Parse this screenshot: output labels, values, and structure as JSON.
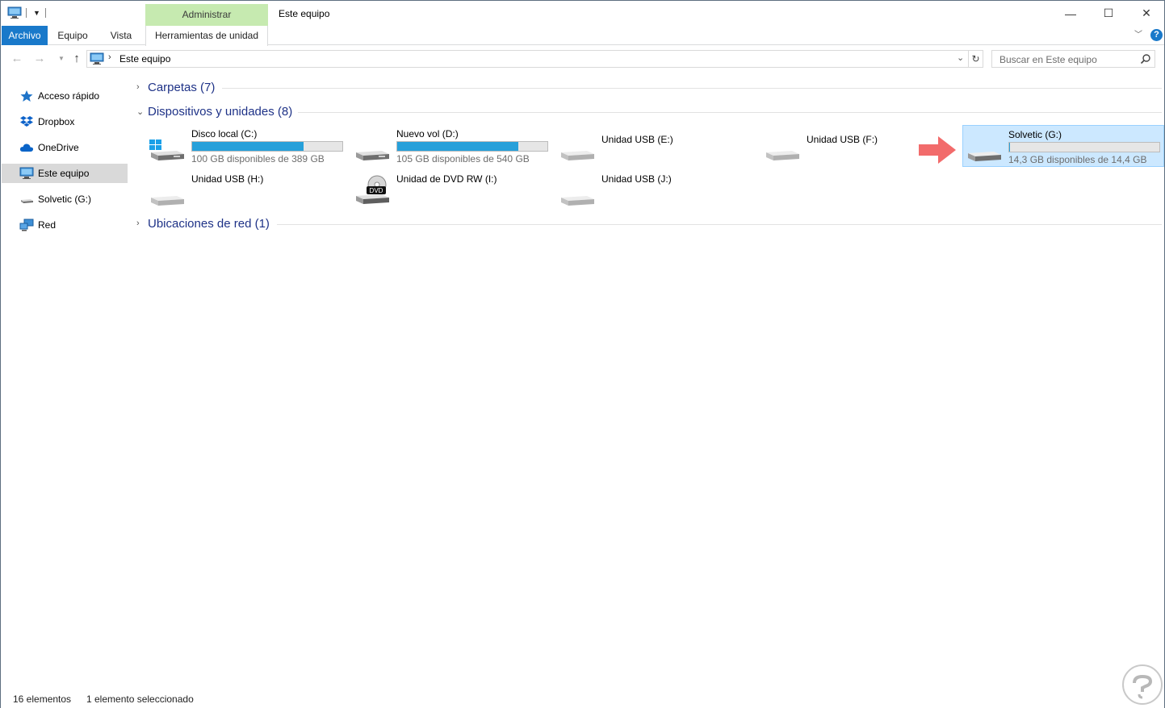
{
  "titlebar": {
    "context_tab": "Administrar",
    "title": "Este equipo",
    "minimize_symbol": "—",
    "maximize_symbol": "☐",
    "close_symbol": "✕"
  },
  "ribbon": {
    "tabs": [
      "Archivo",
      "Equipo",
      "Vista",
      "Herramientas de unidad"
    ],
    "active_tab": "Archivo",
    "accent_color": "#1979ca",
    "context_color": "#c6eab0",
    "help_label": "?"
  },
  "navigation": {
    "address_path": "Este equipo",
    "search_placeholder": "Buscar en Este equipo"
  },
  "sidebar": {
    "items": [
      {
        "label": "Acceso rápido",
        "icon": "star-icon"
      },
      {
        "label": "Dropbox",
        "icon": "dropbox-icon"
      },
      {
        "label": "OneDrive",
        "icon": "cloud-icon"
      },
      {
        "label": "Este equipo",
        "icon": "computer-icon",
        "selected": true
      },
      {
        "label": "Solvetic (G:)",
        "icon": "usb-drive-icon"
      },
      {
        "label": "Red",
        "icon": "network-icon"
      }
    ]
  },
  "content": {
    "groups": [
      {
        "title": "Carpetas (7)",
        "expanded": false
      },
      {
        "title": "Dispositivos y unidades (8)",
        "expanded": true
      },
      {
        "title": "Ubicaciones de red (1)",
        "expanded": false
      }
    ],
    "drives": [
      {
        "name": "Disco local (C:)",
        "free_text": "100 GB disponibles de 389 GB",
        "used_fraction": 0.743,
        "icon": "windows-drive-icon"
      },
      {
        "name": "Nuevo vol (D:)",
        "free_text": "105 GB disponibles de 540 GB",
        "used_fraction": 0.806,
        "icon": "hard-drive-icon"
      },
      {
        "name": "Unidad USB (E:)",
        "icon": "usb-drive-icon"
      },
      {
        "name": "Unidad USB (F:)",
        "icon": "usb-drive-icon"
      },
      {
        "name": "Solvetic (G:)",
        "free_text": "14,3 GB disponibles de 14,4 GB",
        "used_fraction": 0.007,
        "icon": "usb-drive-icon",
        "selected": true
      },
      {
        "name": "Unidad USB (H:)",
        "icon": "usb-drive-icon"
      },
      {
        "name": "Unidad de DVD RW (I:)",
        "icon": "dvd-drive-icon",
        "badge": "DVD"
      },
      {
        "name": "Unidad USB (J:)",
        "icon": "usb-drive-icon"
      }
    ]
  },
  "status": {
    "count": "16 elementos",
    "selection": "1 elemento seleccionado"
  }
}
